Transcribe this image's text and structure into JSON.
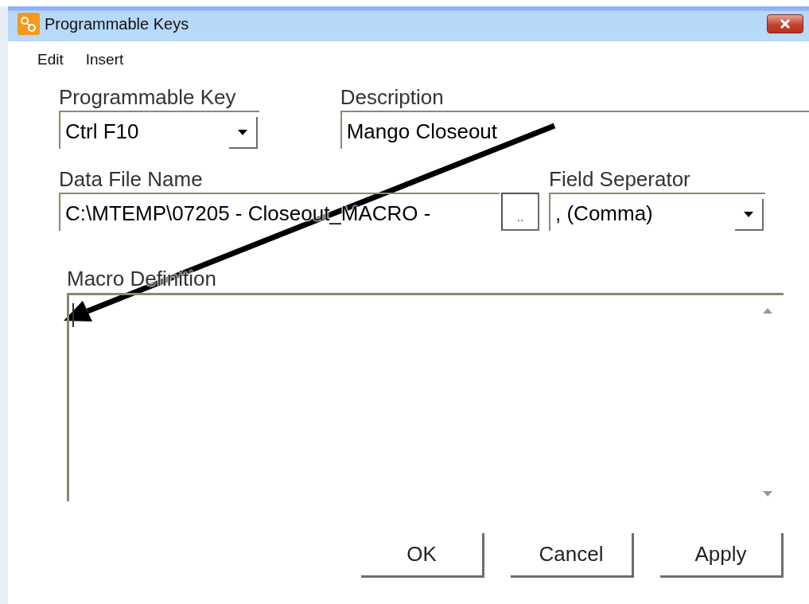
{
  "window": {
    "title": "Programmable Keys"
  },
  "menu": [
    {
      "label": "Edit"
    },
    {
      "label": "Insert"
    }
  ],
  "fields": [
    {
      "kind": "combo",
      "label": "Programmable Key",
      "value": "Ctrl F10"
    },
    {
      "kind": "text",
      "label": "Description",
      "value": "Mango Closeout"
    },
    {
      "kind": "browse",
      "label": "Data File Name",
      "value": "C:\\MTEMP\\07205 - Closeout_MACRO -",
      "button": ".."
    },
    {
      "kind": "combo",
      "label": "Field Seperator",
      "value": ", (Comma)"
    }
  ],
  "macro_definition": {
    "label": "Macro Definition"
  },
  "buttons": [
    "OK",
    "Cancel",
    "Apply"
  ]
}
